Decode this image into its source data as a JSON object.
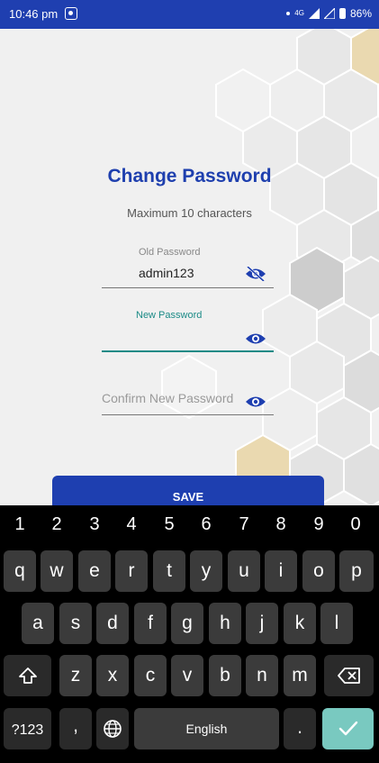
{
  "status_bar": {
    "time": "10:46 pm",
    "net": "4G",
    "battery": "86%"
  },
  "screen": {
    "title": "Change Password",
    "subtitle": "Maximum 10 characters",
    "old_password": {
      "label": "Old Password",
      "value": "admin123"
    },
    "new_password": {
      "label": "New Password",
      "value": ""
    },
    "confirm_password": {
      "placeholder": "Confirm New Password",
      "value": ""
    },
    "save_label": "SAVE"
  },
  "keyboard": {
    "number_row": [
      "1",
      "2",
      "3",
      "4",
      "5",
      "6",
      "7",
      "8",
      "9",
      "0"
    ],
    "row1": [
      "q",
      "w",
      "e",
      "r",
      "t",
      "y",
      "u",
      "i",
      "o",
      "p"
    ],
    "row2": [
      "a",
      "s",
      "d",
      "f",
      "g",
      "h",
      "j",
      "k",
      "l"
    ],
    "row3": [
      "z",
      "x",
      "c",
      "v",
      "b",
      "n",
      "m"
    ],
    "symbols_label": "?123",
    "comma": ",",
    "space_label": "English",
    "period": "."
  },
  "colors": {
    "primary": "#1e3fb0",
    "accent": "#1a8a86",
    "keyboard_bg": "#000000",
    "enter_key": "#79c9c0"
  }
}
